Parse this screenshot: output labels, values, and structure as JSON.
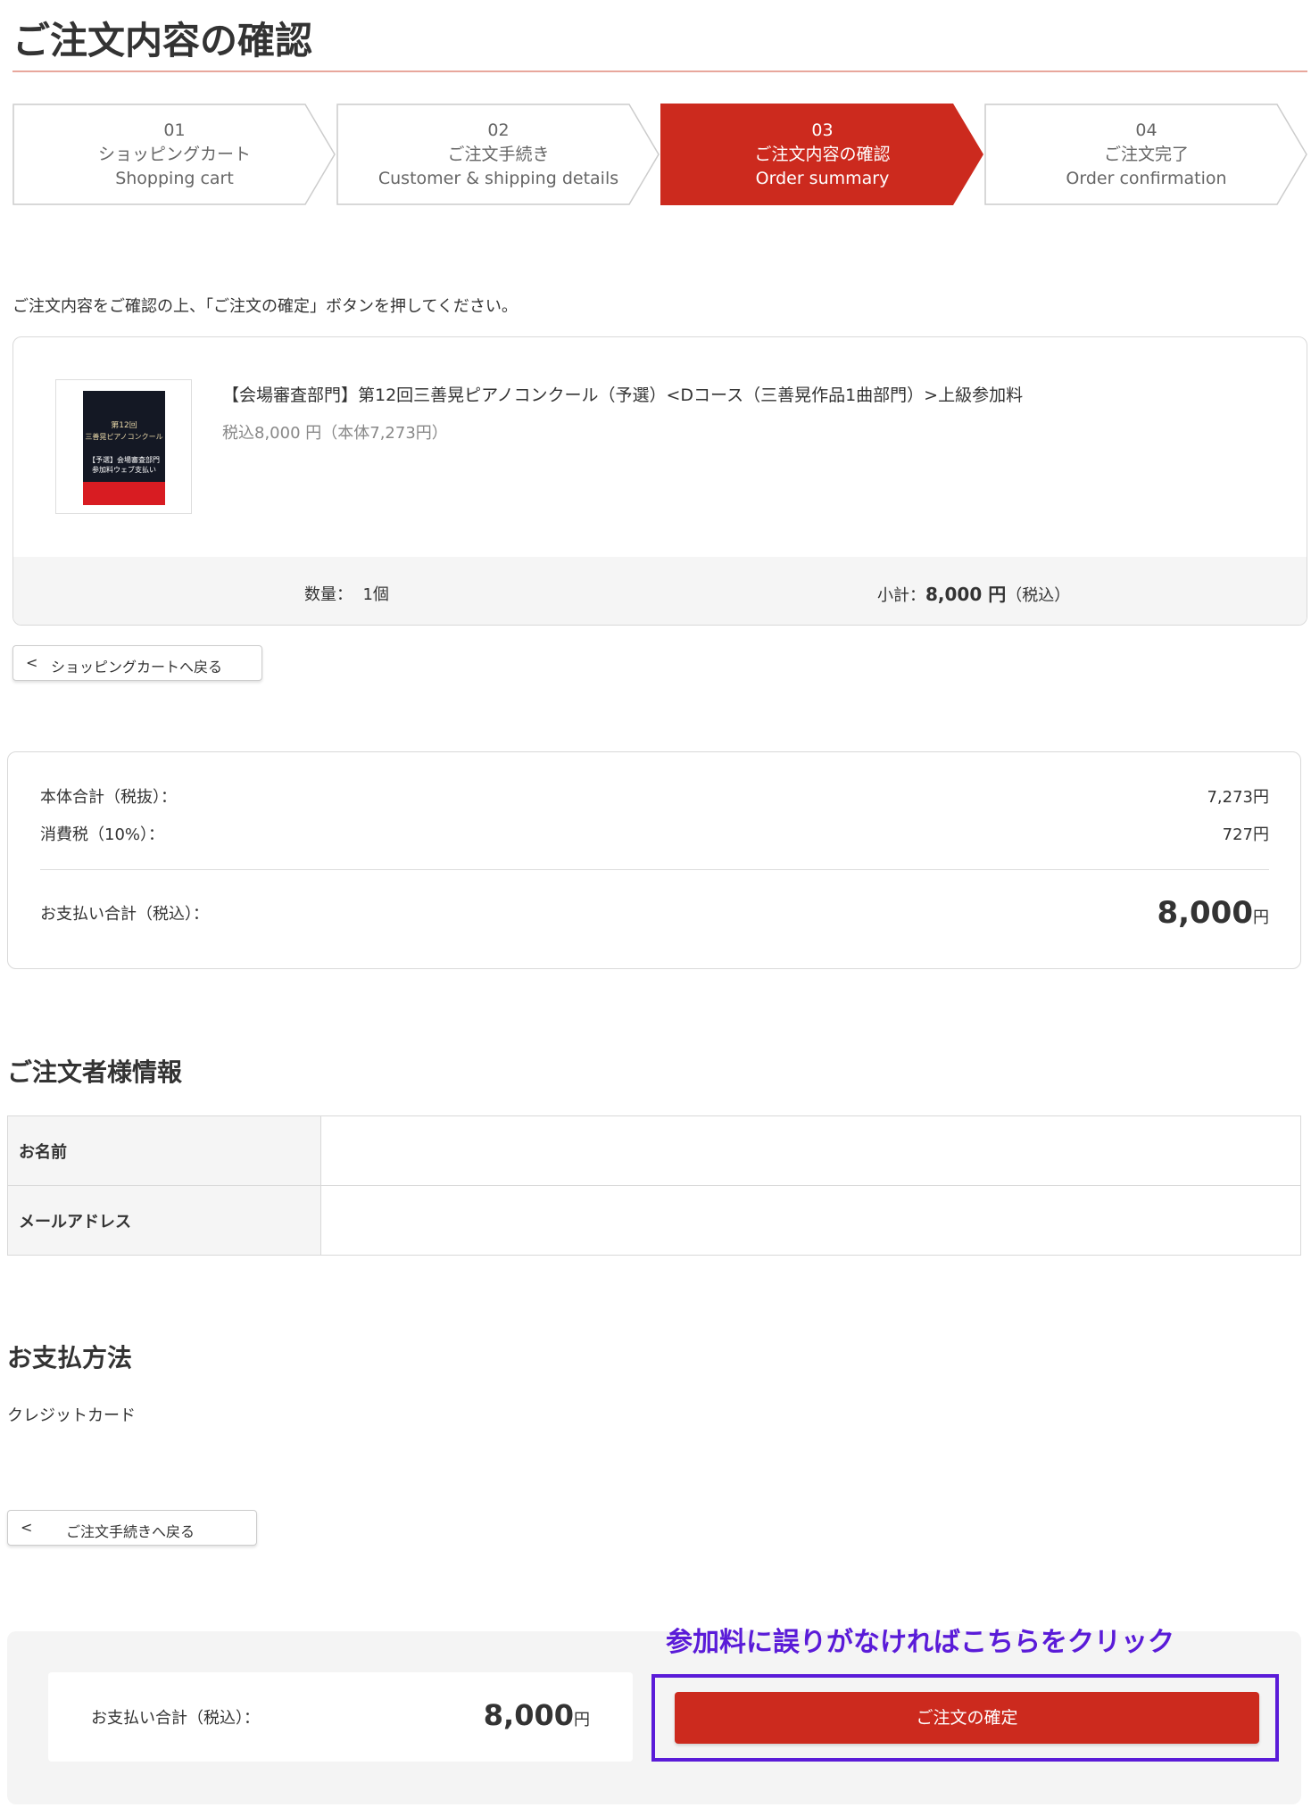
{
  "page": {
    "title": "ご注文内容の確認",
    "intro": "ご注文内容をご確認の上、「ご注文の確定」ボタンを押してください。"
  },
  "steps": [
    {
      "num": "01",
      "ja": "ショッピングカート",
      "en": "Shopping cart",
      "active": false
    },
    {
      "num": "02",
      "ja": "ご注文手続き",
      "en": "Customer & shipping details",
      "active": false
    },
    {
      "num": "03",
      "ja": "ご注文内容の確認",
      "en": "Order summary",
      "active": true
    },
    {
      "num": "04",
      "ja": "ご注文完了",
      "en": "Order confirmation",
      "active": false
    }
  ],
  "colors": {
    "accent": "#cc2a1e",
    "highlight": "#5a1bd8",
    "step_border": "#cccccc",
    "title_rule": "#e8a79c"
  },
  "item": {
    "name": "【会場審査部門】第12回三善晃ピアノコンクール（予選）<Dコース（三善晃作品1曲部門）>上級参加料",
    "price": "税込8,000 円（本体7,273円）",
    "thumbnail": {
      "line1": "第12回",
      "line2": "三善晃ピアノコンクール",
      "line3": "【予選】会場審査部門",
      "line4": "参加料ウェブ支払い"
    },
    "qty_label": "数量：",
    "qty_value": "1個",
    "subtotal_label": "小計：",
    "subtotal_value": "8,000 円",
    "subtotal_tax": "（税込）"
  },
  "back_to_cart": {
    "chevron": "<",
    "label": "ショッピングカートへ戻る"
  },
  "totals": {
    "net_label": "本体合計（税抜）：",
    "net_value": "7,273円",
    "tax_label": "消費税（10%）：",
    "tax_value": "727円",
    "grand_label": "お支払い合計（税込）：",
    "grand_value": "8,000",
    "grand_unit": "円"
  },
  "customer": {
    "heading": "ご注文者様情報",
    "name_label": "お名前",
    "name_value": "",
    "email_label": "メールアドレス",
    "email_value": ""
  },
  "payment": {
    "heading": "お支払方法",
    "method": "クレジットカード"
  },
  "back_to_checkout": {
    "chevron": "<",
    "label": "ご注文手続きへ戻る"
  },
  "bottom": {
    "total_label": "お支払い合計（税込）：",
    "total_value": "8,000",
    "total_unit": "円",
    "hint": "参加料に誤りがなければこちらをクリック",
    "confirm_label": "ご注文の確定"
  }
}
